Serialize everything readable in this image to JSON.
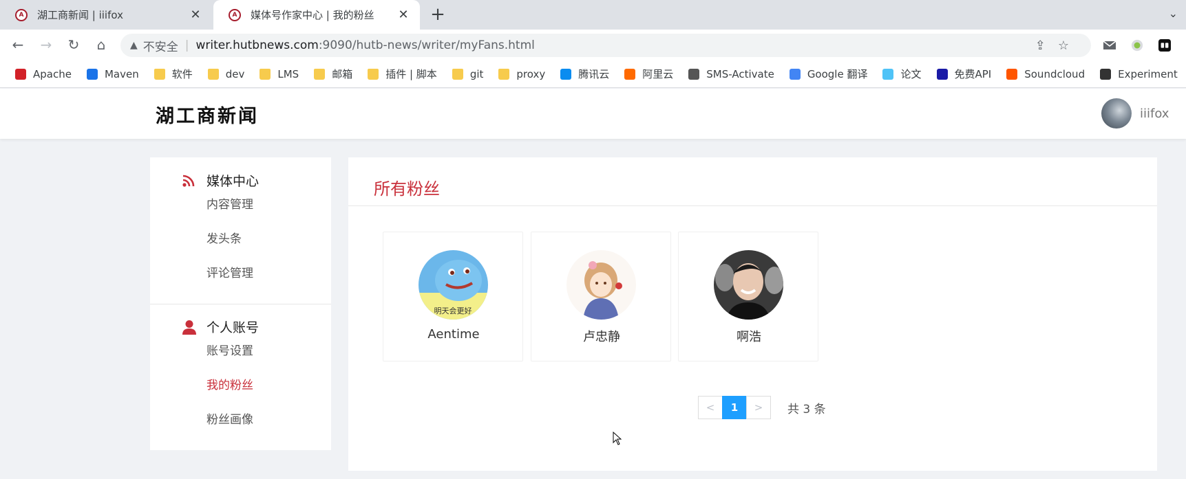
{
  "browser": {
    "tabs": [
      {
        "title": "湖工商新闻 | iiifox",
        "active": false
      },
      {
        "title": "媒体号作家中心 | 我的粉丝",
        "active": true
      }
    ],
    "favicon_text": "A",
    "close_glyph": "✕",
    "new_tab_glyph": "+",
    "tab_menu_glyph": "⌄",
    "nav": {
      "back": "←",
      "forward": "→",
      "reload": "↻",
      "home": "⌂"
    },
    "address": {
      "warning_glyph": "▲",
      "insecure_label": "不安全",
      "separator": "|",
      "host": "writer.hutbnews.com",
      "path": ":9090/hutb-news/writer/myFans.html"
    },
    "bookmarks": [
      {
        "label": "Apache",
        "icon": "feather-icon",
        "color": "#d22128"
      },
      {
        "label": "Maven",
        "icon": "mvn-icon",
        "color": "#1a73e8"
      },
      {
        "label": "软件",
        "icon": "folder-icon"
      },
      {
        "label": "dev",
        "icon": "folder-icon"
      },
      {
        "label": "LMS",
        "icon": "folder-icon"
      },
      {
        "label": "邮箱",
        "icon": "folder-icon"
      },
      {
        "label": "插件 | 脚本",
        "icon": "folder-icon"
      },
      {
        "label": "git",
        "icon": "folder-icon"
      },
      {
        "label": "proxy",
        "icon": "folder-icon"
      },
      {
        "label": "腾讯云",
        "icon": "cloud-icon",
        "color": "#0a8cf0"
      },
      {
        "label": "阿里云",
        "icon": "aliyun-icon",
        "color": "#ff6a00"
      },
      {
        "label": "SMS-Activate",
        "icon": "sms-icon",
        "color": "#555555"
      },
      {
        "label": "Google 翻译",
        "icon": "translate-icon",
        "color": "#4285f4"
      },
      {
        "label": "论文",
        "icon": "paper-icon",
        "color": "#4fc3f7"
      },
      {
        "label": "免费API",
        "icon": "api-icon",
        "color": "#1a1aa6"
      },
      {
        "label": "Soundcloud",
        "icon": "soundcloud-icon",
        "color": "#ff5500"
      },
      {
        "label": "Experiment",
        "icon": "flask-icon",
        "color": "#333333"
      }
    ]
  },
  "site": {
    "logo_text": "湖工商新闻",
    "username": "iiifox"
  },
  "sidebar": {
    "sections": [
      {
        "title": "媒体中心",
        "icon": "rss-icon",
        "items": [
          {
            "label": "内容管理",
            "active": false
          },
          {
            "label": "发头条",
            "active": false
          },
          {
            "label": "评论管理",
            "active": false
          }
        ]
      },
      {
        "title": "个人账号",
        "icon": "user-icon",
        "items": [
          {
            "label": "账号设置",
            "active": false
          },
          {
            "label": "我的粉丝",
            "active": true
          },
          {
            "label": "粉丝画像",
            "active": false
          }
        ]
      }
    ]
  },
  "main": {
    "title": "所有粉丝",
    "fans": [
      {
        "name": "Aentime",
        "avatar_caption": "明天会更好"
      },
      {
        "name": "卢忠静"
      },
      {
        "name": "啊浩"
      }
    ],
    "pagination": {
      "prev": "<",
      "current": "1",
      "next": ">",
      "total_text": "共 3 条"
    }
  },
  "colors": {
    "accent": "#c9303b",
    "pager_active": "#1e9fff",
    "page_bg": "#f0f2f5"
  }
}
